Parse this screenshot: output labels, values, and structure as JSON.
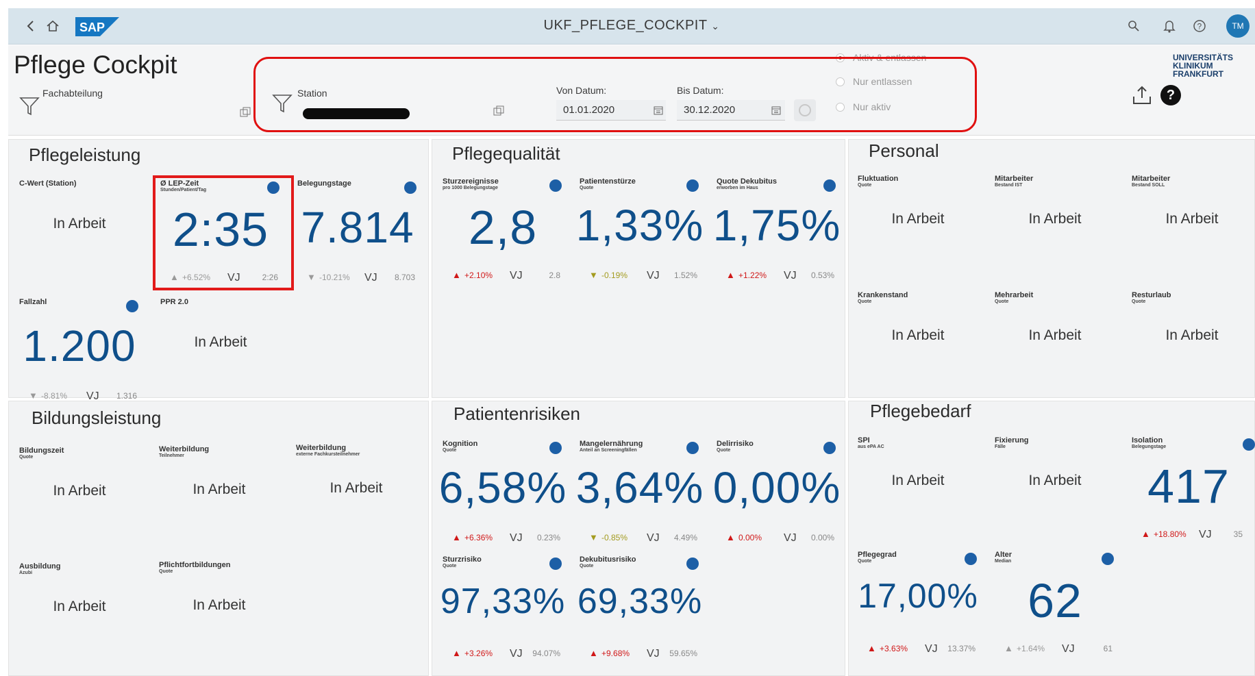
{
  "shell": {
    "title": "UKF_PFLEGE_COCKPIT",
    "avatar": "TM",
    "logo": "SAP"
  },
  "header": {
    "page_title": "Pflege Cockpit",
    "filter1_label": "Fachabteilung",
    "filter2_label": "Station",
    "von_label": "Von Datum:",
    "von_value": "01.01.2020",
    "bis_label": "Bis Datum:",
    "bis_value": "30.12.2020",
    "radio": [
      "Aktiv & entlassen",
      "Nur entlassen",
      "Nur aktiv"
    ],
    "logo_line1": "UNIVERSITÄTS",
    "logo_line2": "KLINIKUM FRANKFURT"
  },
  "sections": {
    "pflegeleistung": "Pflegeleistung",
    "pflegequalitaet": "Pflegequalität",
    "personal": "Personal",
    "bildungsleistung": "Bildungsleistung",
    "patientenrisiken": "Patientenrisiken",
    "pflegebedarf": "Pflegebedarf"
  },
  "tiles": {
    "cwert": {
      "title": "C-Wert (Station)",
      "sub": "",
      "status": "In Arbeit"
    },
    "lep": {
      "title": "Ø LEP-Zeit",
      "sub": "Stunden/Patient/Tag",
      "value": "2:35",
      "pct": "+6.52%",
      "vj": "VJ",
      "prev": "2:26"
    },
    "belegung": {
      "title": "Belegungstage",
      "sub": "",
      "value": "7.814",
      "pct": "-10.21%",
      "vj": "VJ",
      "prev": "8.703"
    },
    "fallzahl": {
      "title": "Fallzahl",
      "sub": "",
      "value": "1.200",
      "pct": "-8.81%",
      "vj": "VJ",
      "prev": "1.316"
    },
    "ppr": {
      "title": "PPR 2.0",
      "sub": "",
      "status": "In Arbeit"
    },
    "sturzereig": {
      "title": "Sturzereignisse",
      "sub": "pro 1000 Belegungstage",
      "value": "2,8",
      "pct": "+2.10%",
      "vj": "VJ",
      "prev": "2.8"
    },
    "patstuerze": {
      "title": "Patientenstürze",
      "sub": "Quote",
      "value": "1,33%",
      "pct": "-0.19%",
      "vj": "VJ",
      "prev": "1.52%"
    },
    "dekubitus": {
      "title": "Quote Dekubitus",
      "sub": "erworben im Haus",
      "value": "1,75%",
      "pct": "+1.22%",
      "vj": "VJ",
      "prev": "0.53%"
    },
    "fluktuation": {
      "title": "Fluktuation",
      "sub": "Quote",
      "status": "In Arbeit"
    },
    "mitarb_ist": {
      "title": "Mitarbeiter",
      "sub": "Bestand IST",
      "status": "In Arbeit"
    },
    "mitarb_soll": {
      "title": "Mitarbeiter",
      "sub": "Bestand SOLL",
      "status": "In Arbeit"
    },
    "krankenstand": {
      "title": "Krankenstand",
      "sub": "Quote",
      "status": "In Arbeit"
    },
    "mehrarbeit": {
      "title": "Mehrarbeit",
      "sub": "Quote",
      "status": "In Arbeit"
    },
    "resturlaub": {
      "title": "Resturlaub",
      "sub": "Quote",
      "status": "In Arbeit"
    },
    "bildungszeit": {
      "title": "Bildungszeit",
      "sub": "Quote",
      "status": "In Arbeit"
    },
    "weiterbildung1": {
      "title": "Weiterbildung",
      "sub": "Teilnehmer",
      "status": "In Arbeit"
    },
    "weiterbildung2": {
      "title": "Weiterbildung",
      "sub": "externe Fachkursteilnehmer",
      "status": "In Arbeit"
    },
    "ausbildung": {
      "title": "Ausbildung",
      "sub": "Azubi",
      "status": "In Arbeit"
    },
    "pflichtfort": {
      "title": "Pflichtfortbildungen",
      "sub": "Quote",
      "status": "In Arbeit"
    },
    "kognition": {
      "title": "Kognition",
      "sub": "Quote",
      "value": "6,58%",
      "pct": "+6.36%",
      "vj": "VJ",
      "prev": "0.23%"
    },
    "mangel": {
      "title": "Mangelernährung",
      "sub": "Anteil an Screeningfällen",
      "value": "3,64%",
      "pct": "-0.85%",
      "vj": "VJ",
      "prev": "4.49%"
    },
    "delir": {
      "title": "Delirrisiko",
      "sub": "Quote",
      "value": "0,00%",
      "pct": "0.00%",
      "vj": "VJ",
      "prev": "0.00%"
    },
    "sturzrisiko": {
      "title": "Sturzrisiko",
      "sub": "Quote",
      "value": "97,33%",
      "pct": "+3.26%",
      "vj": "VJ",
      "prev": "94.07%"
    },
    "dekrisiko": {
      "title": "Dekubitusrisiko",
      "sub": "Quote",
      "value": "69,33%",
      "pct": "+9.68%",
      "vj": "VJ",
      "prev": "59.65%"
    },
    "spi": {
      "title": "SPI",
      "sub": "aus ePA AC",
      "status": "In Arbeit"
    },
    "fixierung": {
      "title": "Fixierung",
      "sub": "Fälle",
      "status": "In Arbeit"
    },
    "isolation": {
      "title": "Isolation",
      "sub": "Belegungstage",
      "value": "417",
      "pct": "+18.80%",
      "vj": "VJ",
      "prev": "35"
    },
    "pflegegrad": {
      "title": "Pflegegrad",
      "sub": "Quote",
      "value": "17,00%",
      "pct": "+3.63%",
      "vj": "VJ",
      "prev": "13.37%"
    },
    "alter": {
      "title": "Alter",
      "sub": "Median",
      "value": "62",
      "pct": "+1.64%",
      "vj": "VJ",
      "prev": "61"
    }
  },
  "colors": {
    "accent": "#1d5fa6",
    "up": "#d01818",
    "down": "#a39b1f",
    "highlight": "#e01010"
  }
}
